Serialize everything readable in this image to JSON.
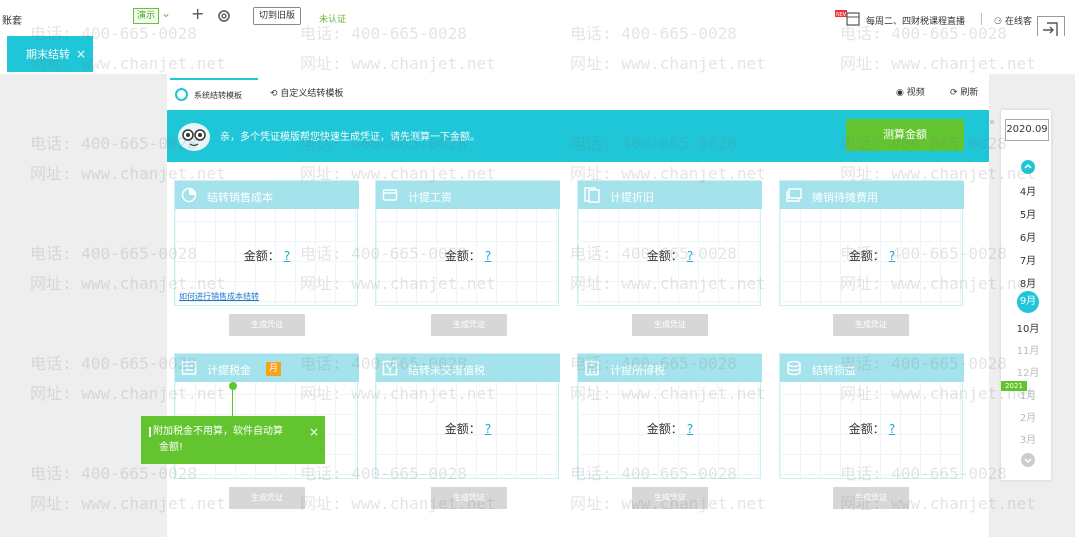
{
  "topbar": {
    "account_label": "账套",
    "demo_badge": "演示",
    "switch_old_version": "切到旧版",
    "unverified": "未认证",
    "news_badge": "NEW",
    "news_text": "每周二、四财税课程直播",
    "online_service": "在线客"
  },
  "tabs": [
    {
      "label": "期末结转",
      "close": "×"
    }
  ],
  "subtabs": {
    "system_template": "系统结转模板",
    "custom_template": "自定义结转模板",
    "video": "视频",
    "refresh": "刷新"
  },
  "banner": {
    "message": "亲，多个凭证模版帮您快速生成凭证，请先测算一下金额。",
    "calc_button": "测算金额"
  },
  "amount_label": "金额：",
  "amount_value": "?",
  "generate_label": "生成凭证",
  "cards": [
    {
      "title": "结转销售成本",
      "icon": "pie-chart-icon",
      "link": "如何进行销售成本结转"
    },
    {
      "title": "计提工资",
      "icon": "wallet-icon"
    },
    {
      "title": "计提折旧",
      "icon": "document-stack-icon"
    },
    {
      "title": "摊销待摊费用",
      "icon": "money-icon"
    },
    {
      "title": "计提税金",
      "icon": "tax-icon",
      "badge": "月"
    },
    {
      "title": "结转未交增值税",
      "icon": "vat-icon"
    },
    {
      "title": "计提所得税",
      "icon": "calculator-icon"
    },
    {
      "title": "结转损益",
      "icon": "coins-icon"
    }
  ],
  "tooltip": {
    "line1": "附加税金不用算，软件自动算",
    "line2": "金额!",
    "close": "×"
  },
  "month_rail": {
    "current_period": "2020.09",
    "months": [
      "4月",
      "5月",
      "6月",
      "7月",
      "8月",
      "9月",
      "10月",
      "11月",
      "12月",
      "1月",
      "2月",
      "3月"
    ],
    "selected": "9月",
    "next_year": "2021"
  },
  "watermark": {
    "phone": "电话: 400-665-0028",
    "url": "网址: www.chanjet.net"
  },
  "colors": {
    "accent": "#1ec6d8",
    "green": "#62c52f",
    "card_head": "#a5e3ec",
    "badge": "#f7a21b"
  }
}
